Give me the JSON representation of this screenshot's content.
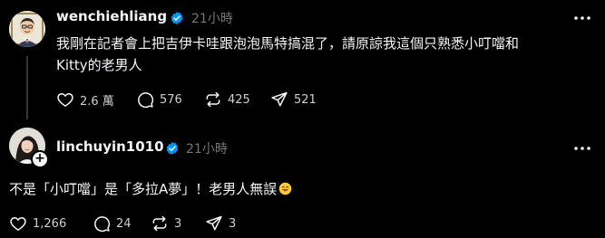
{
  "colors": {
    "background": "#000000",
    "text": "#f3f5f7",
    "secondary": "#777777",
    "verified": "#0095f6",
    "thread_line": "#333638"
  },
  "post1": {
    "username": "wenchiehliang",
    "verified": true,
    "time": "21小時",
    "text_line1": "我剛在記者會上把吉伊卡哇跟泡泡馬特搞混了，請原諒我這個只熟悉小叮噹和",
    "text_line2": "Kitty的老男人",
    "actions": {
      "likes": "2.6 萬",
      "comments": "576",
      "reposts": "425",
      "shares": "521"
    }
  },
  "post2": {
    "username": "linchuyin1010",
    "verified": true,
    "time": "21小時",
    "text": "不是「小叮噹」是「多拉A夢」！老男人無誤",
    "emoji": "smiling-face-with-tongue-emoji",
    "actions": {
      "likes": "1,266",
      "comments": "24",
      "reposts": "3",
      "shares": "3"
    }
  },
  "icons": {
    "more": "more-options-icon",
    "like": "heart-icon",
    "comment": "comment-icon",
    "repost": "repost-icon",
    "share": "share-icon",
    "follow": "plus-icon"
  }
}
